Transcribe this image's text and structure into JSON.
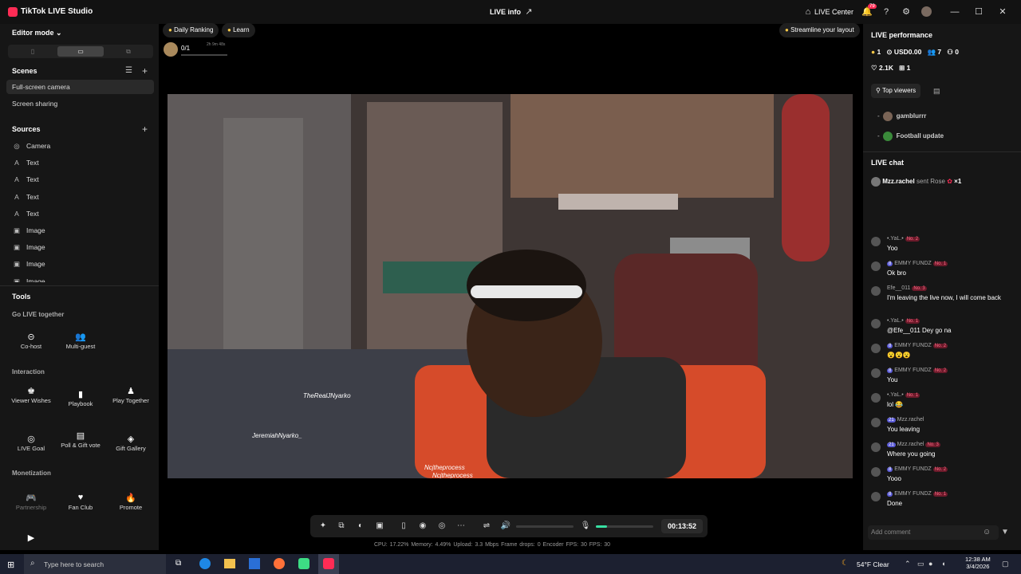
{
  "titlebar": {
    "app_title": "TikTok LIVE Studio",
    "center_title": "LIVE info",
    "live_center": "LIVE Center",
    "notif_count": "79"
  },
  "left": {
    "editor_mode": "Editor mode",
    "scenes_title": "Scenes",
    "scenes": [
      "Full-screen camera",
      "Screen sharing"
    ],
    "sources_title": "Sources",
    "sources": [
      {
        "icon": "camera-icon",
        "glyph": "◎",
        "label": "Camera"
      },
      {
        "icon": "text-icon",
        "glyph": "A",
        "label": "Text"
      },
      {
        "icon": "text-icon",
        "glyph": "A",
        "label": "Text"
      },
      {
        "icon": "text-icon",
        "glyph": "A",
        "label": "Text"
      },
      {
        "icon": "text-icon",
        "glyph": "A",
        "label": "Text"
      },
      {
        "icon": "image-icon",
        "glyph": "▣",
        "label": "Image"
      },
      {
        "icon": "image-icon",
        "glyph": "▣",
        "label": "Image"
      },
      {
        "icon": "image-icon",
        "glyph": "▣",
        "label": "Image"
      },
      {
        "icon": "image-icon",
        "glyph": "▣",
        "label": "Image"
      }
    ],
    "tools_title": "Tools",
    "go_live_together": "Go LIVE together",
    "cohost": "Co-host",
    "multiguest": "Multi-guest",
    "interaction": "Interaction",
    "viewer_wishes": "Viewer Wishes",
    "playbook": "Playbook",
    "play_together": "Play Together",
    "live_goal": "LIVE Goal",
    "poll_gift": "Poll & Gift vote",
    "gift_gallery": "Gift Gallery",
    "monetization": "Monetization",
    "partnership": "Partnership",
    "fan_club": "Fan Club",
    "promote": "Promote"
  },
  "center": {
    "daily_ranking": "Daily Ranking",
    "learn": "Learn",
    "rank_count": "0/1",
    "rank_timer": "2h 9m 48s",
    "streamline": "Streamline your layout",
    "overlay_texts": [
      "TheRealJNyarko",
      "JeremiahNyarko_",
      "Ncjtheprocess",
      "Ncjtheprocess"
    ],
    "timer": "00:13:52",
    "volume_level": 0.65,
    "mic_level": 0.2,
    "stats": "CPU: 17.22%    Memory: 4.49%    Upload: 3.3 Mbps    Frame drops: 0    Encoder FPS: 30    FPS: 30"
  },
  "right": {
    "perf_title": "LIVE performance",
    "metrics": {
      "rank": "1",
      "coins": "USD0.00",
      "viewers": "7",
      "new": "0",
      "likes": "2.1K",
      "gifts": "1"
    },
    "top_viewers": "Top viewers",
    "viewers": [
      "gamblurrr",
      "Football update"
    ],
    "live_chat": "LIVE chat",
    "gift_user": "Mzz.rachel",
    "gift_text": "sent Rose",
    "gift_count": "×1",
    "chat": [
      {
        "user": "•.YaL.•",
        "lvl": "",
        "badge": "No. 2",
        "text": "Yoo"
      },
      {
        "user": "EMMY FUNDZ",
        "lvl": "8",
        "badge": "No. 1",
        "text": "Ok bro"
      },
      {
        "user": "Efe__011",
        "lvl": "",
        "badge": "No. 3",
        "text": "I'm leaving the live now, I will come back"
      },
      {
        "user": "•.YaL.•",
        "lvl": "",
        "badge": "No. 1",
        "text": "@Efe__011 Dey go na"
      },
      {
        "user": "EMMY FUNDZ",
        "lvl": "8",
        "badge": "No. 2",
        "text": "😮😮😮"
      },
      {
        "user": "EMMY FUNDZ",
        "lvl": "8",
        "badge": "No. 2",
        "text": "You"
      },
      {
        "user": "•.YaL.•",
        "lvl": "",
        "badge": "No. 1",
        "text": "lol 😂"
      },
      {
        "user": "Mzz.rachel",
        "lvl": "21",
        "badge": "",
        "text": "You leaving"
      },
      {
        "user": "Mzz.rachel",
        "lvl": "21",
        "badge": "No. 3",
        "text": "Where you going"
      },
      {
        "user": "EMMY FUNDZ",
        "lvl": "8",
        "badge": "No. 2",
        "text": "Yooo"
      },
      {
        "user": "EMMY FUNDZ",
        "lvl": "8",
        "badge": "No. 1",
        "text": "Done"
      }
    ],
    "add_comment": "Add comment"
  },
  "taskbar": {
    "search": "Type here to search",
    "weather": "54°F Clear",
    "time": "12:38 AM",
    "date": "3/4/2026"
  },
  "colors": {
    "accent": "#fe2c55",
    "panel": "#161616",
    "level": "#5b5bd6"
  }
}
